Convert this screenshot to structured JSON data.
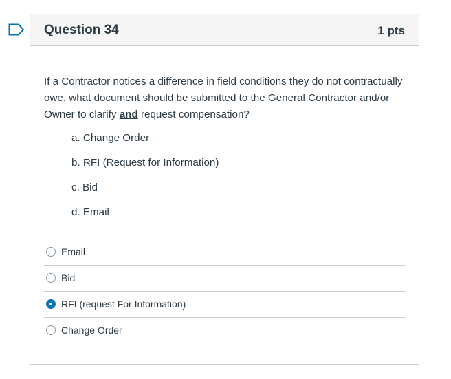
{
  "colors": {
    "accent": "#0374b5",
    "border": "#c7cdd1",
    "header_bg": "#f5f5f5",
    "text": "#2d3b45"
  },
  "flag_icon": "bookmark-flag-icon",
  "question": {
    "title": "Question 34",
    "points": "1 pts",
    "text_before": "If a Contractor notices a difference in field conditions they do not contractually owe, what document should be submitted to the General Contractor and/or Owner to clarify ",
    "text_emphasis": "and",
    "text_after": " request compensation?",
    "choices": [
      "a. Change Order",
      "b. RFI (Request for Information)",
      "c. Bid",
      "d. Email"
    ]
  },
  "answers": [
    {
      "label": "Email",
      "selected": false
    },
    {
      "label": "Bid",
      "selected": false
    },
    {
      "label": "RFI (request For Information)",
      "selected": true
    },
    {
      "label": "Change Order",
      "selected": false
    }
  ]
}
